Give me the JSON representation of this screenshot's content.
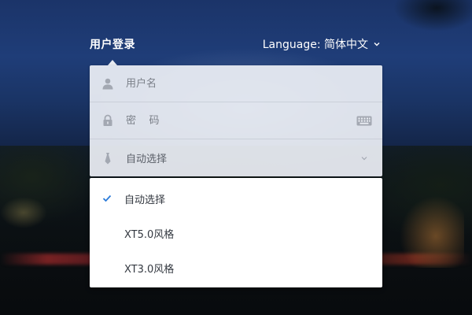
{
  "header": {
    "title": "用户登录",
    "language_label": "Language: 简体中文"
  },
  "form": {
    "username_placeholder": "用户名",
    "password_placeholder": "密    码",
    "style_select_value": "自动选择"
  },
  "dropdown": {
    "options": [
      {
        "label": "自动选择",
        "selected": true
      },
      {
        "label": "XT5.0风格",
        "selected": false
      },
      {
        "label": "XT3.0风格",
        "selected": false
      }
    ]
  },
  "colors": {
    "accent_check": "#2b7bd9",
    "form_bg": "#eceff5",
    "icon_gray": "#a3a8b2"
  }
}
